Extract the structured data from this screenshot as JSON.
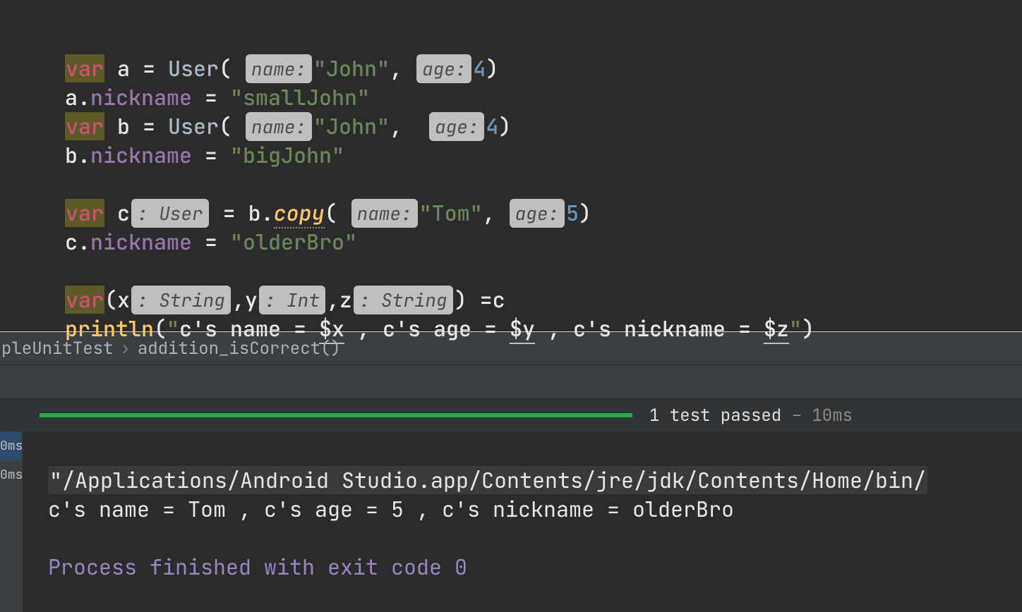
{
  "code": {
    "l1": {
      "var": "var",
      "name": "a",
      "eq": " = ",
      "ctor": "User",
      "h_name": "name:",
      "v_name": "\"John\"",
      "comma": ",",
      "h_age": "age:",
      "v_age": "4"
    },
    "l2": {
      "obj": "a",
      "mbr": "nickname",
      "eq": " = ",
      "val": "\"smallJohn\""
    },
    "l3": {
      "var": "var",
      "name": "b",
      "eq": " = ",
      "ctor": "User",
      "h_name": "name:",
      "v_name": "\"John\"",
      "comma": ",",
      "h_age": "age:",
      "v_age": "4"
    },
    "l4": {
      "obj": "b",
      "mbr": "nickname",
      "eq": " = ",
      "val": "\"bigJohn\""
    },
    "l5": {
      "var": "var",
      "name": "c",
      "h_type": ": User",
      "eq": " = ",
      "recv": "b",
      "call": "copy",
      "h_name": "name:",
      "v_name": "\"Tom\"",
      "comma": ",",
      "h_age": "age:",
      "v_age": "5"
    },
    "l6": {
      "obj": "c",
      "mbr": "nickname",
      "eq": " = ",
      "val": "\"olderBro\""
    },
    "l7": {
      "var": "var",
      "x": "x",
      "hx": ": String",
      "y": "y",
      "hy": ": Int",
      "z": "z",
      "hz": ": String",
      "eq": " =",
      "rhs": "c"
    },
    "l8": {
      "fn": "println",
      "q": "\"",
      "p1": "c's name = ",
      "v1": "$x",
      "p2": " , c's age = ",
      "v2": "$y",
      "p3": " , c's nickname = ",
      "v3": "$z"
    }
  },
  "breadcrumb": {
    "a": "pleUnitTest",
    "b": "addition_isCorrect()"
  },
  "results": {
    "passed": "1 test passed",
    "time": "– 10ms"
  },
  "gutter": {
    "r1": "0ms",
    "r2": "0ms"
  },
  "console": {
    "cmd": "\"/Applications/Android Studio.app/Contents/jre/jdk/Contents/Home/bin/",
    "out": "c's name = Tom , c's age = 5 , c's nickname = olderBro",
    "exit": "Process finished with exit code 0"
  }
}
